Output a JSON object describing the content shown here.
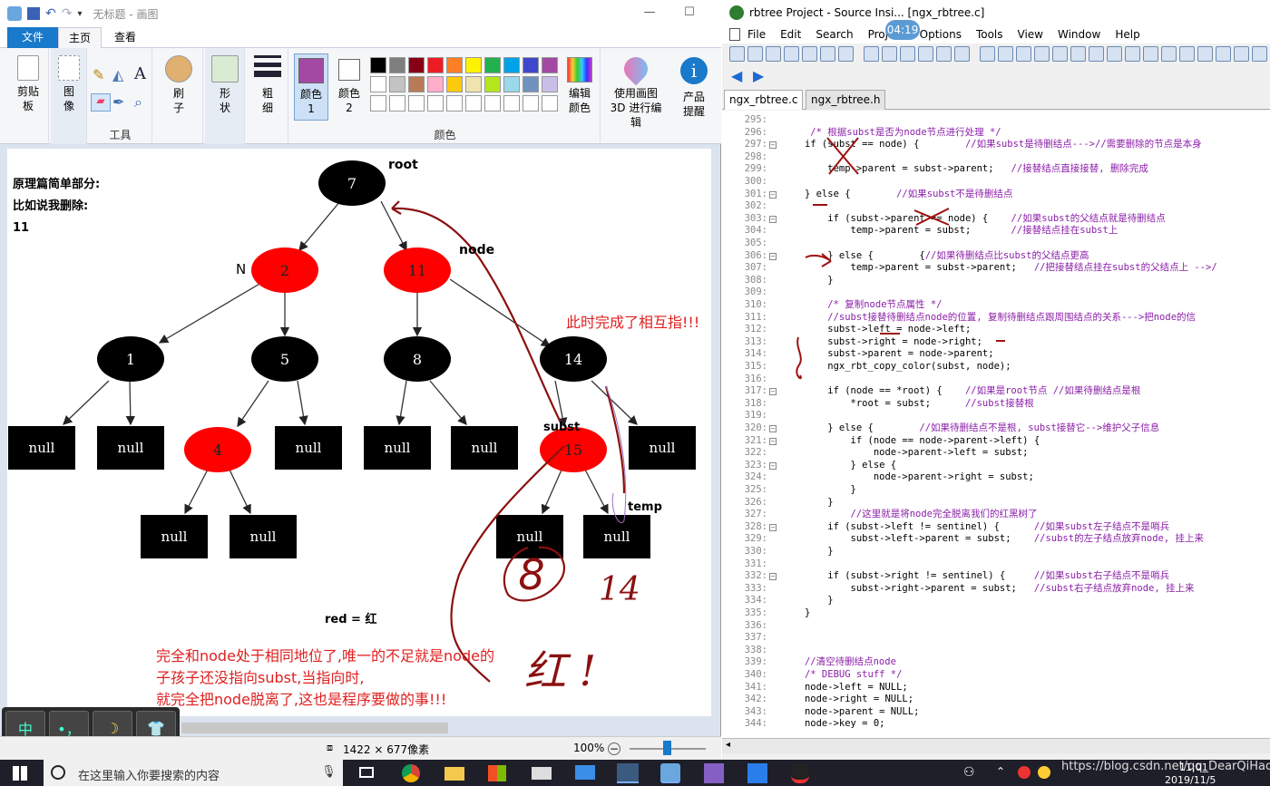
{
  "paint": {
    "title": "无标题 - 画图",
    "tabs": [
      "文件",
      "主页",
      "查看"
    ],
    "ribbon": {
      "clipboard": "剪贴板",
      "image": "图像",
      "tools_label": "工具",
      "brush": "刷子",
      "shapes": "形状",
      "size": "粗细",
      "color1": "颜色 1",
      "color2": "颜色 2",
      "colors_label": "颜色",
      "edit_colors": "编辑颜色",
      "paint3d": "使用画图 3D 进行编辑",
      "product_alert": "产品提醒",
      "selected_color": "#a349a4",
      "swatches_row1": [
        "#000000",
        "#7f7f7f",
        "#880015",
        "#ed1c24",
        "#ff7f27",
        "#fff200",
        "#22b14c",
        "#00a2e8",
        "#3f48cc",
        "#a349a4"
      ],
      "swatches_row2": [
        "#ffffff",
        "#c3c3c3",
        "#b97a57",
        "#ffaec9",
        "#ffc90e",
        "#efe4b0",
        "#b5e61d",
        "#99d9ea",
        "#7092be",
        "#c8bfe7"
      ]
    },
    "canvas": {
      "intro_lines": [
        "原理篇简单部分:",
        "比如说我删除:",
        "11"
      ],
      "label_root": "root",
      "label_node": "node",
      "label_N": "N",
      "label_subst": "subst",
      "label_temp": "temp",
      "legend": "red = 红",
      "annotation_right": "此时完成了相互指!!!",
      "annotation_bottom": [
        "完全和node处于相同地位了,唯一的不足就是node的",
        "子孩子还没指向subst,当指向时,",
        "就完全把node脱离了,这也是程序要做的事!!!"
      ],
      "handwritten_8": "8",
      "handwritten_14": "14",
      "handwritten_red": "红 !",
      "nodes": [
        {
          "key": "7",
          "color": "black"
        },
        {
          "key": "2",
          "color": "red"
        },
        {
          "key": "11",
          "color": "red"
        },
        {
          "key": "1",
          "color": "black"
        },
        {
          "key": "5",
          "color": "black"
        },
        {
          "key": "8",
          "color": "black"
        },
        {
          "key": "14",
          "color": "black"
        },
        {
          "key": "4",
          "color": "red"
        },
        {
          "key": "15",
          "color": "red"
        }
      ],
      "null_label": "null"
    },
    "status": {
      "size": "1422 × 677像素",
      "zoom": "100%"
    }
  },
  "ime": [
    "中",
    "•，",
    "☽",
    "👕"
  ],
  "sourceinsight": {
    "title": "rbtree Project - Source Insi... [ngx_rbtree.c]",
    "timer": "04:19",
    "menu": [
      "File",
      "Edit",
      "Search",
      "Project",
      "Options",
      "Tools",
      "View",
      "Window",
      "Help"
    ],
    "tabs": [
      "ngx_rbtree.c",
      "ngx_rbtree.h"
    ],
    "lines": [
      {
        "n": "295:",
        "t": ""
      },
      {
        "n": "296:",
        "t": "    /* 根据subst是否为node节点进行处理 */"
      },
      {
        "n": "297:",
        "t": "   if (subst == node) {        //如果subst是待删结点--->//需要删除的节点是本身"
      },
      {
        "n": "298:",
        "t": ""
      },
      {
        "n": "299:",
        "t": "       temp->parent = subst->parent;   //接替结点直接接替, 删除完成"
      },
      {
        "n": "300:",
        "t": ""
      },
      {
        "n": "301:",
        "t": "   } else {        //如果subst不是待删结点"
      },
      {
        "n": "302:",
        "t": ""
      },
      {
        "n": "303:",
        "t": "       if (subst->parent == node) {    //如果subst的父结点就是待删结点"
      },
      {
        "n": "304:",
        "t": "           temp->parent = subst;       //接替结点挂在subst上"
      },
      {
        "n": "305:",
        "t": ""
      },
      {
        "n": "306:",
        "t": "       } else {        {//如果待删结点比subst的父结点更高"
      },
      {
        "n": "307:",
        "t": "           temp->parent = subst->parent;   //把接替结点挂在subst的父结点上 -->/"
      },
      {
        "n": "308:",
        "t": "       }"
      },
      {
        "n": "309:",
        "t": ""
      },
      {
        "n": "310:",
        "t": "       /* 复制node节点属性 */"
      },
      {
        "n": "311:",
        "t": "       //subst接替待删结点node的位置, 复制待删结点跟周围结点的关系--->把node的信"
      },
      {
        "n": "312:",
        "t": "       subst->left = node->left;"
      },
      {
        "n": "313:",
        "t": "       subst->right = node->right;"
      },
      {
        "n": "314:",
        "t": "       subst->parent = node->parent;"
      },
      {
        "n": "315:",
        "t": "       ngx_rbt_copy_color(subst, node);"
      },
      {
        "n": "316:",
        "t": ""
      },
      {
        "n": "317:",
        "t": "       if (node == *root) {    //如果是root节点 //如果待删结点是根"
      },
      {
        "n": "318:",
        "t": "           *root = subst;      //subst接替根"
      },
      {
        "n": "319:",
        "t": ""
      },
      {
        "n": "320:",
        "t": "       } else {        //如果待删结点不是根, subst接替它-->维护父子信息"
      },
      {
        "n": "321:",
        "t": "           if (node == node->parent->left) {"
      },
      {
        "n": "322:",
        "t": "               node->parent->left = subst;"
      },
      {
        "n": "323:",
        "t": "           } else {"
      },
      {
        "n": "324:",
        "t": "               node->parent->right = subst;"
      },
      {
        "n": "325:",
        "t": "           }"
      },
      {
        "n": "326:",
        "t": "       }"
      },
      {
        "n": "327:",
        "t": "           //这里就是将node完全脱离我们的红黑树了"
      },
      {
        "n": "328:",
        "t": "       if (subst->left != sentinel) {      //如果subst左子结点不是哨兵"
      },
      {
        "n": "329:",
        "t": "           subst->left->parent = subst;    //subst的左子结点放弃node, 挂上来"
      },
      {
        "n": "330:",
        "t": "       }"
      },
      {
        "n": "331:",
        "t": ""
      },
      {
        "n": "332:",
        "t": "       if (subst->right != sentinel) {     //如果subst右子结点不是哨兵"
      },
      {
        "n": "333:",
        "t": "           subst->right->parent = subst;   //subst右子结点放弃node, 挂上来"
      },
      {
        "n": "334:",
        "t": "       }"
      },
      {
        "n": "335:",
        "t": "   }"
      },
      {
        "n": "336:",
        "t": ""
      },
      {
        "n": "337:",
        "t": ""
      },
      {
        "n": "338:",
        "t": ""
      },
      {
        "n": "339:",
        "t": "   //清空待删结点node"
      },
      {
        "n": "340:",
        "t": "   /* DEBUG stuff */"
      },
      {
        "n": "341:",
        "t": "   node->left = NULL;"
      },
      {
        "n": "342:",
        "t": "   node->right = NULL;"
      },
      {
        "n": "343:",
        "t": "   node->parent = NULL;"
      },
      {
        "n": "344:",
        "t": "   node->key = 0;"
      }
    ]
  },
  "taskbar": {
    "search_placeholder": "在这里输入你要搜索的内容",
    "time": "11:01",
    "date": "2019/11/5",
    "watermark": "https://blog.csdn.net/qq_DearQiHao"
  }
}
